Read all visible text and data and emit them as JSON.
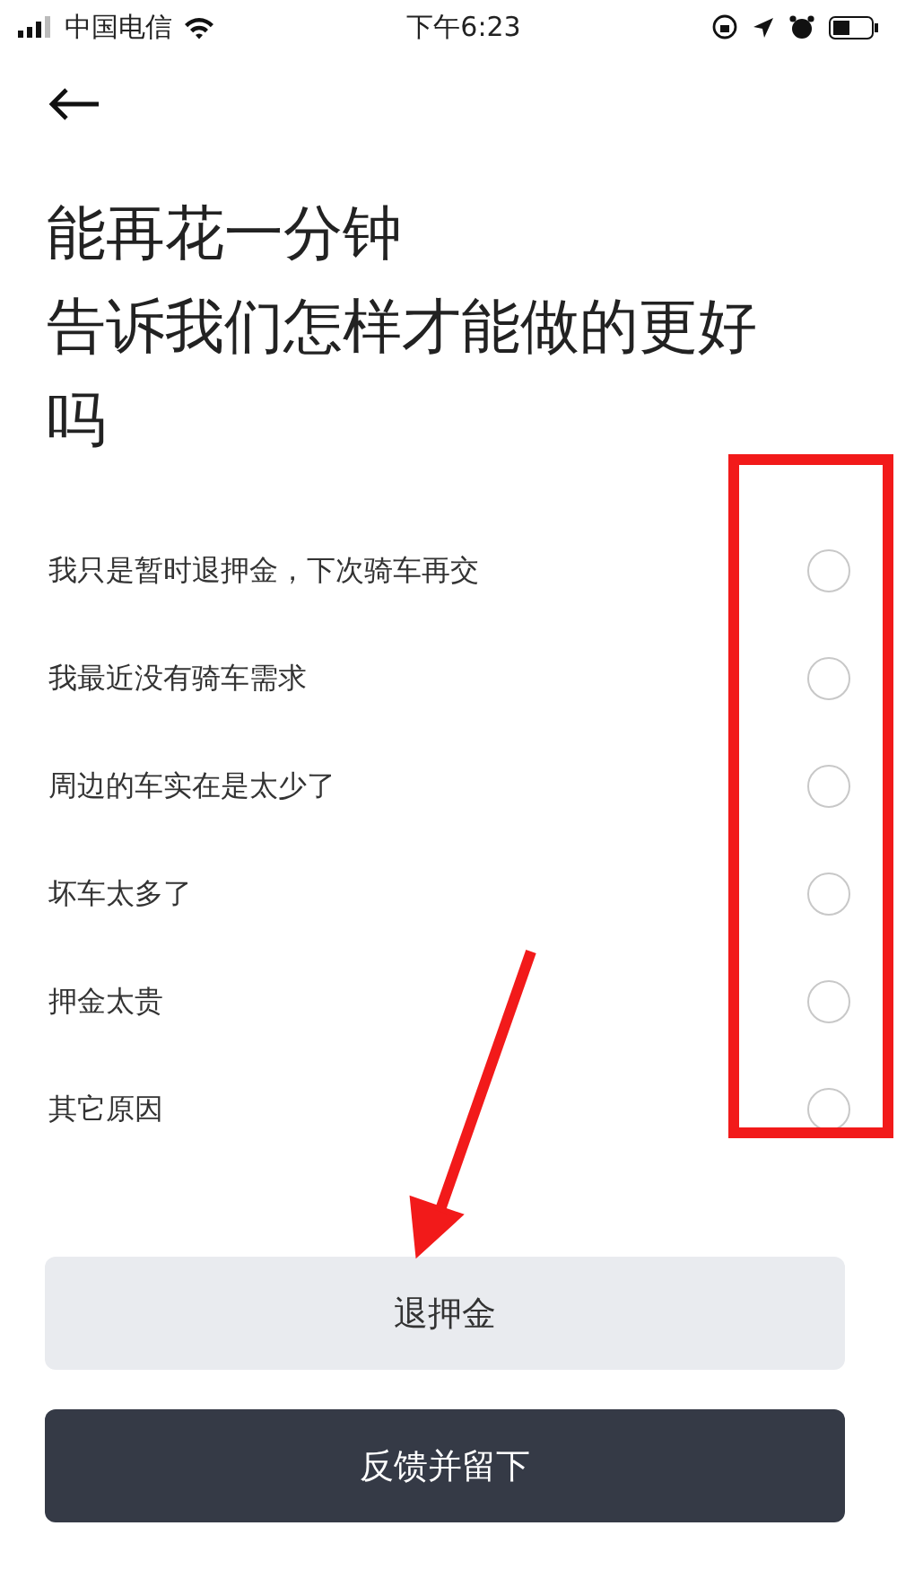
{
  "status_bar": {
    "carrier": "中国电信",
    "time": "下午6:23"
  },
  "title_lines": [
    "能再花一分钟",
    "告诉我们怎样才能做的更好吗"
  ],
  "options": [
    {
      "label": "我只是暂时退押金，下次骑车再交",
      "selected": false
    },
    {
      "label": "我最近没有骑车需求",
      "selected": false
    },
    {
      "label": "周边的车实在是太少了",
      "selected": false
    },
    {
      "label": "坏车太多了",
      "selected": false
    },
    {
      "label": "押金太贵",
      "selected": false
    },
    {
      "label": "其它原因",
      "selected": false
    }
  ],
  "buttons": [
    {
      "label": "退押金",
      "kind": "secondary"
    },
    {
      "label": "反馈并留下",
      "kind": "primary"
    }
  ]
}
